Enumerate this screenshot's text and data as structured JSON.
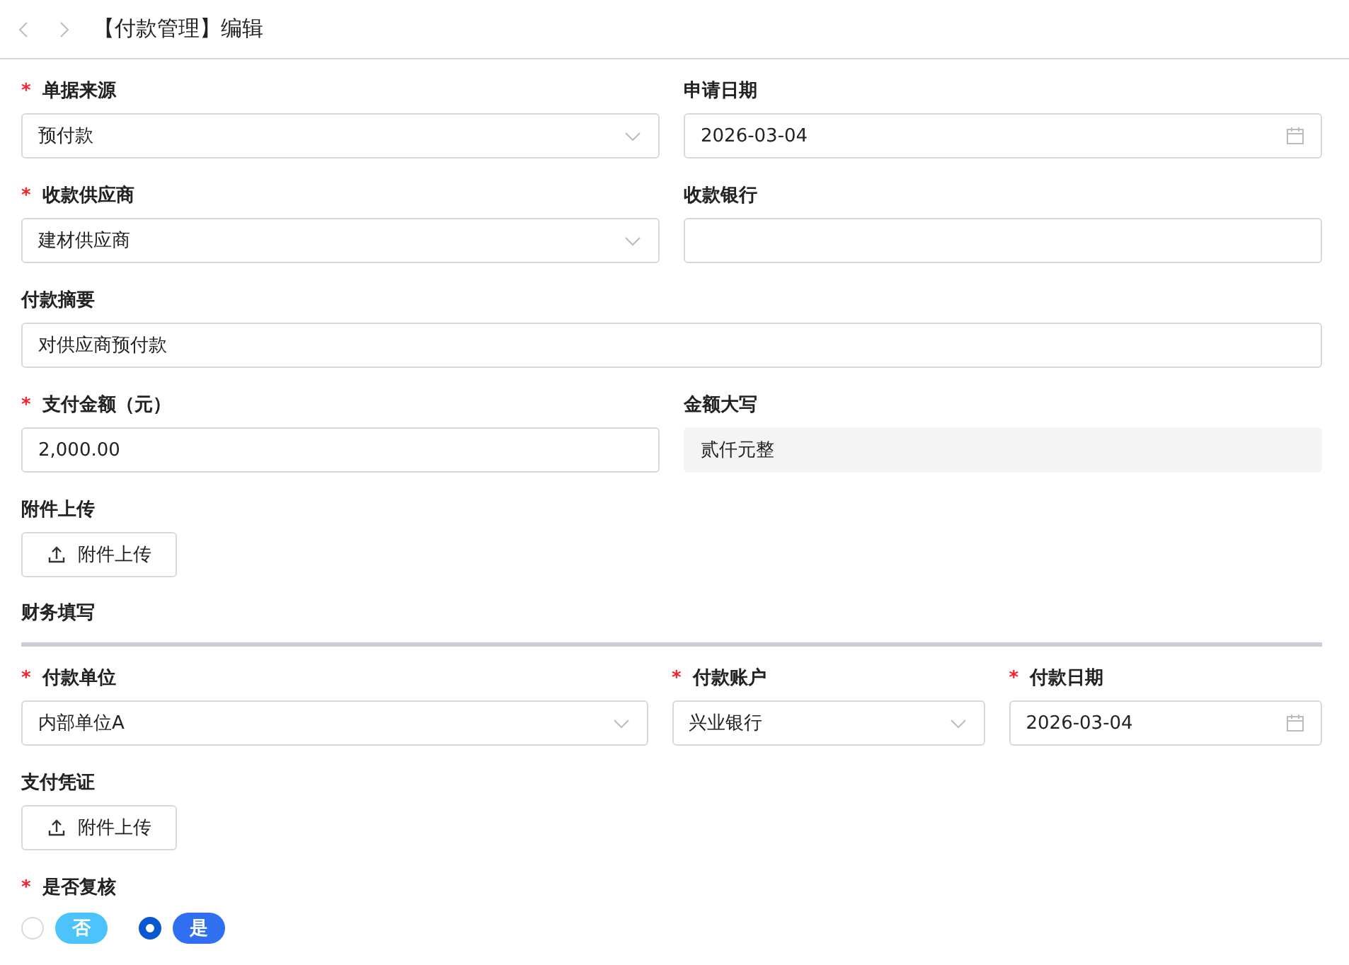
{
  "header": {
    "title": "【付款管理】编辑"
  },
  "sections": [
    {
      "rows": [
        [
          {
            "label": "单据来源",
            "mark": "*",
            "kind": "select",
            "value": "预付款"
          },
          {
            "label": "申请日期",
            "kind": "date",
            "value": "2026-03-04"
          }
        ],
        [
          {
            "label": "收款供应商",
            "mark": "*",
            "kind": "select",
            "value": "建材供应商"
          },
          {
            "label": "收款银行",
            "kind": "text"
          }
        ],
        [
          {
            "label": "付款摘要",
            "kind": "text",
            "value": "对供应商预付款"
          }
        ],
        [
          {
            "label": "支付金额（元）",
            "mark": "*",
            "kind": "text",
            "value": "2,000.00"
          },
          {
            "label": "金额大写",
            "kind": "readonly",
            "value": "贰仟元整"
          }
        ],
        [
          {
            "label": "附件上传",
            "kind": "upload",
            "value": "附件上传"
          }
        ]
      ]
    },
    {
      "title": "财务填写",
      "rows": [
        [
          {
            "label": "付款单位",
            "mark": "*",
            "kind": "select",
            "value": "内部单位A"
          },
          {
            "label": "付款账户",
            "mark": "*",
            "kind": "select",
            "value": "兴业银行"
          },
          {
            "label": "付款日期",
            "mark": "*",
            "kind": "date",
            "value": "2026-03-04"
          }
        ],
        [
          {
            "label": "支付凭证",
            "kind": "upload",
            "value": "附件上传"
          }
        ],
        [
          {
            "label": "是否复核",
            "mark": "*",
            "kind": "radio",
            "options": [
              {
                "label": "否",
                "selected": false,
                "color": "#4cc3fb"
              },
              {
                "label": "是",
                "selected": true,
                "color": "#2f6ff0"
              }
            ]
          }
        ]
      ]
    }
  ]
}
